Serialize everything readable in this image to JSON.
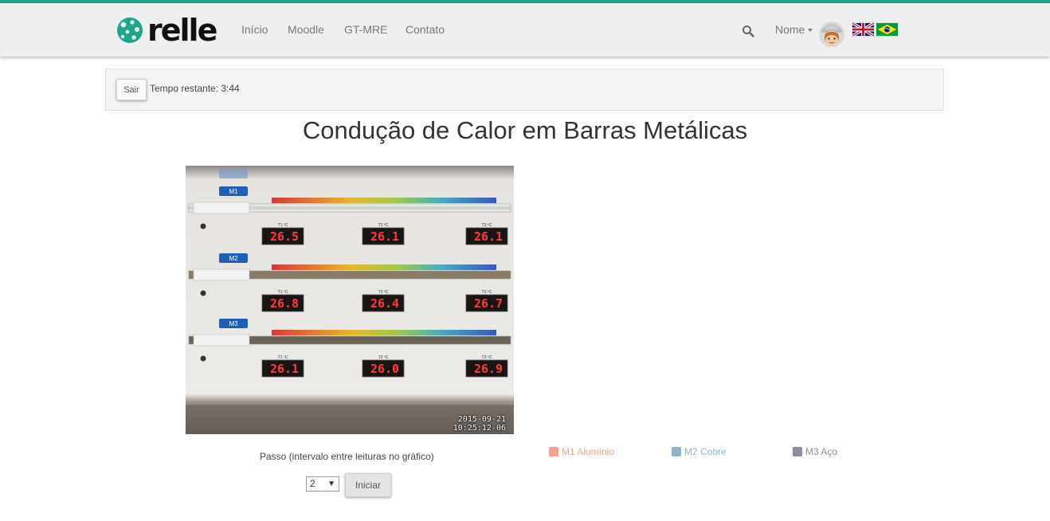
{
  "navbar": {
    "brand": "relle",
    "links": [
      "Início",
      "Moodle",
      "GT-MRE",
      "Contato"
    ],
    "user_name": "Nome",
    "accent_color": "#1fa58a"
  },
  "session": {
    "exit_label": "Sair",
    "time_remaining": "Tempo restante: 3:44"
  },
  "experiment": {
    "title": "Condução de Calor em Barras Metálicas",
    "camera": {
      "bars": [
        {
          "label": "M1",
          "readings": [
            "26.5",
            "26.1",
            "26.1"
          ]
        },
        {
          "label": "M2",
          "readings": [
            "26.8",
            "26.4",
            "26.7"
          ]
        },
        {
          "label": "M3",
          "readings": [
            "26.1",
            "26.0",
            "26.9"
          ]
        }
      ],
      "sensor_labels": [
        "T1 ºC",
        "T2 ºC",
        "T3 ºC"
      ],
      "timestamp_date": "2015-09-21",
      "timestamp_time": "10:25:12-06"
    },
    "legend": [
      {
        "label": "M1 Alumínio",
        "color": "#f4a28c"
      },
      {
        "label": "M2 Cobre",
        "color": "#8fb4cc"
      },
      {
        "label": "M3 Aço",
        "color": "#8f8a9c"
      }
    ],
    "step_label": "Passo (intervalo entre leituras no gráfico)",
    "step_value": "2",
    "start_label": "Iniciar"
  }
}
